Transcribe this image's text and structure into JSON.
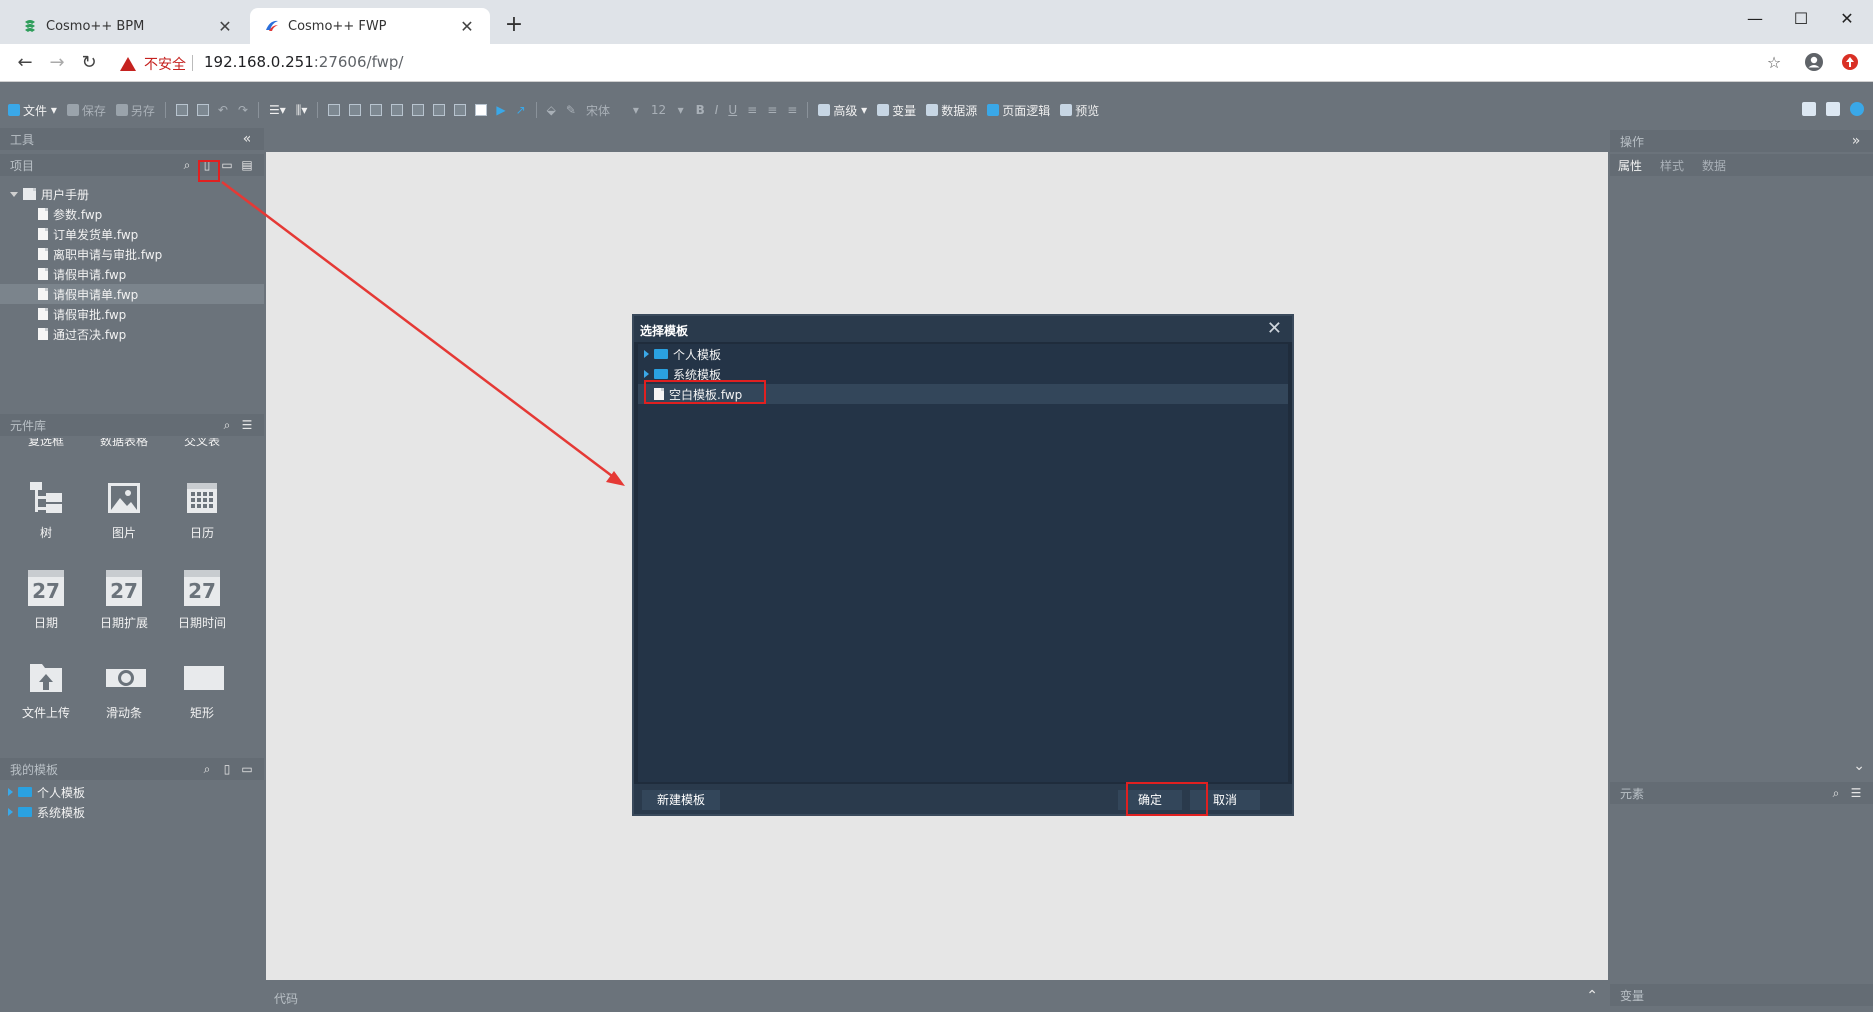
{
  "browser": {
    "tabs": [
      {
        "title": "Cosmo++ BPM",
        "active": false
      },
      {
        "title": "Cosmo++ FWP",
        "active": true
      }
    ],
    "security_label": "不安全",
    "url_host": "192.168.0.251",
    "url_rest": ":27606/fwp/"
  },
  "toolbar": {
    "file": "文件",
    "save": "保存",
    "save_as": "另存",
    "font_name": "宋体",
    "font_size": "12",
    "advanced": "高级",
    "variables": "变量",
    "datasource": "数据源",
    "page_logic": "页面逻辑",
    "preview": "预览"
  },
  "left": {
    "tools_header": "工具",
    "project_header": "项目",
    "project_root": "用户手册",
    "project_files": [
      "参数.fwp",
      "订单发货单.fwp",
      "离职申请与审批.fwp",
      "请假申请.fwp",
      "请假申请单.fwp",
      "请假审批.fwp",
      "通过否决.fwp"
    ],
    "library_header": "元件库",
    "library_partial": [
      "复选框",
      "数据表格",
      "交叉表"
    ],
    "library_items": [
      {
        "label": "树",
        "icon": "tree-icon"
      },
      {
        "label": "图片",
        "icon": "image-icon"
      },
      {
        "label": "日历",
        "icon": "calendar-grid-icon"
      },
      {
        "label": "日期",
        "icon": "date-icon",
        "num": "27"
      },
      {
        "label": "日期扩展",
        "icon": "date-ext-icon",
        "num": "27"
      },
      {
        "label": "日期时间",
        "icon": "datetime-icon",
        "num": "27"
      },
      {
        "label": "文件上传",
        "icon": "file-upload-icon"
      },
      {
        "label": "滑动条",
        "icon": "slider-icon"
      },
      {
        "label": "矩形",
        "icon": "rectangle-icon"
      }
    ],
    "templates_header": "我的模板",
    "template_folders": [
      "个人模板",
      "系统模板"
    ]
  },
  "center": {
    "code_label": "代码"
  },
  "right": {
    "ops_header": "操作",
    "tabs": [
      "属性",
      "样式",
      "数据"
    ],
    "elements_header": "元素",
    "variables_header": "变量"
  },
  "dialog": {
    "title": "选择模板",
    "folders": [
      "个人模板",
      "系统模板"
    ],
    "file": "空白模板.fwp",
    "new_template": "新建模板",
    "ok": "确定",
    "cancel": "取消"
  },
  "colors": {
    "panel": "#6b737b",
    "canvas": "#e6e6e6",
    "dialog_bg": "#243447",
    "highlight": "#e02020"
  }
}
